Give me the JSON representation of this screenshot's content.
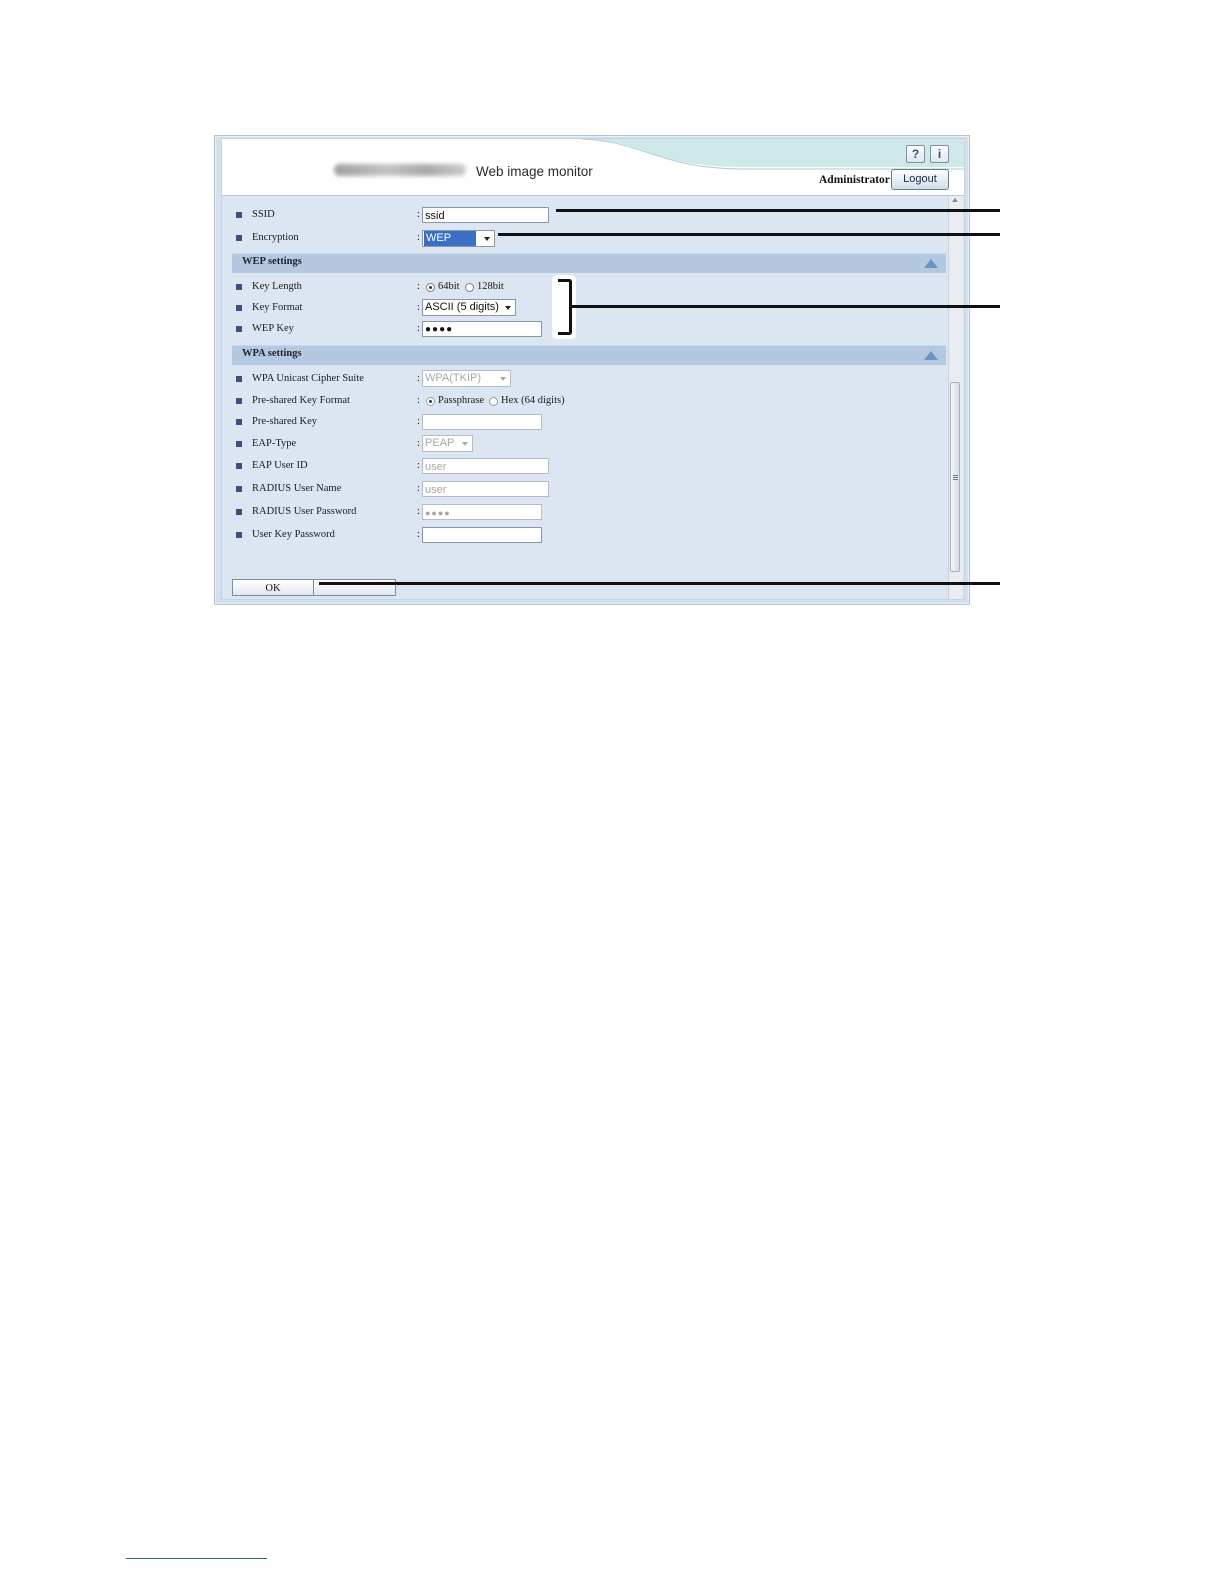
{
  "header": {
    "app_title": "Web image monitor",
    "help_icon_label": "?",
    "info_icon_label": "i",
    "user": "Administrator",
    "logout_label": "Logout"
  },
  "fields": {
    "ssid": {
      "label": "SSID",
      "value": "ssid"
    },
    "encryption": {
      "label": "Encryption",
      "value": "WEP"
    }
  },
  "wep": {
    "title": "WEP settings",
    "key_length": {
      "label": "Key Length",
      "options": [
        "64bit",
        "128bit"
      ],
      "selected": "64bit"
    },
    "key_format": {
      "label": "Key Format",
      "value": "ASCII (5 digits)"
    },
    "wep_key": {
      "label": "WEP Key",
      "value": "●●●●"
    }
  },
  "wpa": {
    "title": "WPA settings",
    "cipher_suite": {
      "label": "WPA Unicast Cipher Suite",
      "value": "WPA(TKIP)"
    },
    "psk_format": {
      "label": "Pre-shared Key Format",
      "options": [
        "Passphrase",
        "Hex (64 digits)"
      ],
      "selected": "Passphrase"
    },
    "psk": {
      "label": "Pre-shared Key",
      "value": ""
    },
    "eap_type": {
      "label": "EAP-Type",
      "value": "PEAP"
    },
    "eap_user_id": {
      "label": "EAP User ID",
      "value": "user"
    },
    "radius_user_name": {
      "label": "RADIUS User Name",
      "value": "user"
    },
    "radius_user_password": {
      "label": "RADIUS User Password",
      "value": "●●●●"
    },
    "user_key_password": {
      "label": "User Key Password",
      "value": ""
    }
  },
  "colon": ":",
  "actions": {
    "ok_label": "OK"
  },
  "colors": {
    "page_bg": "#dbe6f2",
    "section_bar": "#b4c9e0",
    "selection": "#3a6fc4"
  }
}
